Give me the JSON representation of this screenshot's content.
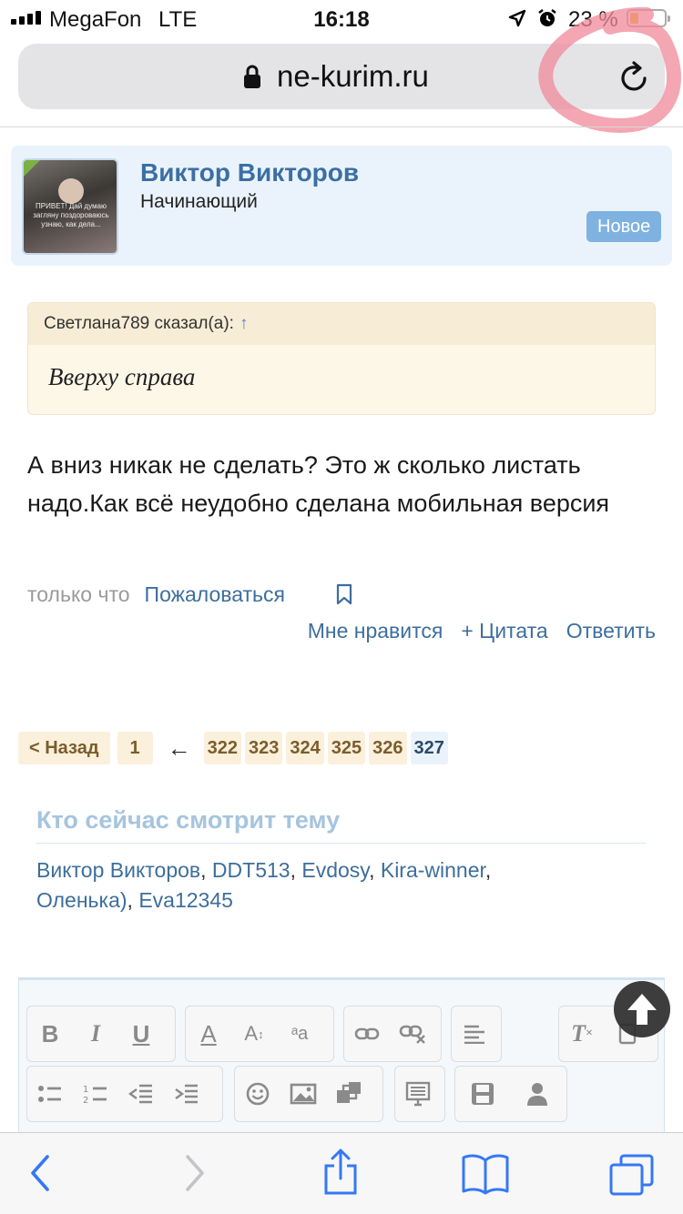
{
  "status_bar": {
    "carrier": "MegaFon",
    "network": "LTE",
    "time": "16:18",
    "battery_text": "23 %"
  },
  "address_bar": {
    "url": "ne-kurim.ru"
  },
  "user_card": {
    "name": "Виктор Викторов",
    "rank": "Начинающий",
    "badge": "Новое",
    "avatar_caption": "ПРИВЕТ! Дай думаю загляну поздороваюсь узнаю, как дела..."
  },
  "quote": {
    "author": "Светлана789 сказал(а):",
    "up_arrow": "↑",
    "text": "Вверху справа"
  },
  "message": {
    "text": "А вниз никак не сделать? Это ж сколько листать надо.Как всё неудобно сделана мобильная версия"
  },
  "meta": {
    "time": "только что",
    "report": "Пожаловаться"
  },
  "actions": {
    "like": "Мне нравится",
    "quote": "+ Цитата",
    "reply": "Ответить"
  },
  "pagination": {
    "back": "< Назад",
    "first": "1",
    "arrow": "←",
    "pages": [
      "322",
      "323",
      "324",
      "325",
      "326"
    ],
    "current": "327"
  },
  "viewers": {
    "title": "Кто сейчас смотрит тему",
    "users": [
      "Виктор Викторов",
      "DDT513",
      "Evdosy",
      "Kira-winner",
      "Оленька)",
      "Eva12345"
    ]
  },
  "toolbar": {
    "row1": [
      "bold-icon",
      "italic-icon",
      "underline-icon",
      "font-color-icon",
      "font-size-icon",
      "font-family-icon",
      "link-icon",
      "unlink-icon",
      "align-icon",
      "remove-format-icon",
      "more-icon"
    ],
    "row2": [
      "bullet-list-icon",
      "numbered-list-icon",
      "outdent-icon",
      "indent-icon",
      "smiley-icon",
      "image-icon",
      "media-icon",
      "template-icon",
      "save-draft-icon",
      "user-icon"
    ]
  },
  "colors": {
    "link": "#3d6e9c",
    "accent": "#3b6fa3",
    "badge": "#7fb2e0",
    "quote_bg": "#fdf7e8",
    "card_bg": "#eaf3fb"
  }
}
